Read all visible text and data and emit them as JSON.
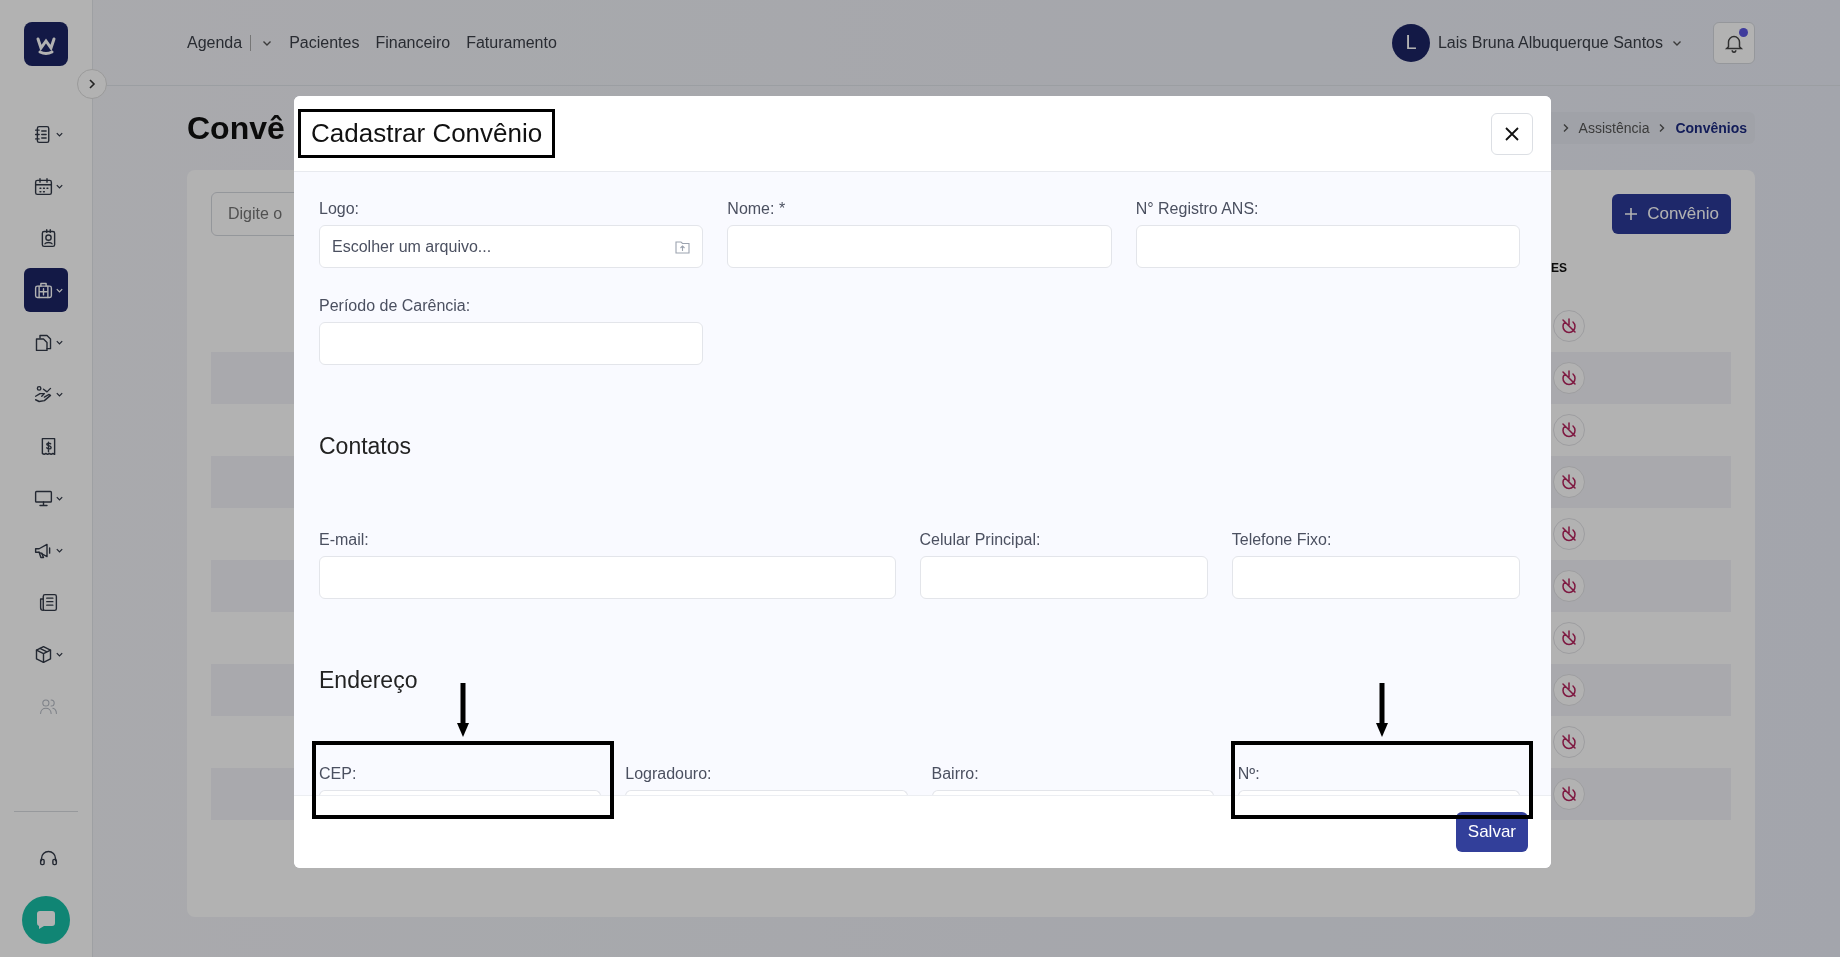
{
  "sidebar": {
    "items": [
      {
        "selected": false,
        "expandable": true,
        "disabled": false
      },
      {
        "selected": false,
        "expandable": true,
        "disabled": false
      },
      {
        "selected": false,
        "expandable": false,
        "disabled": false
      },
      {
        "selected": true,
        "expandable": true,
        "disabled": false
      },
      {
        "selected": false,
        "expandable": true,
        "disabled": false
      },
      {
        "selected": false,
        "expandable": true,
        "disabled": false
      },
      {
        "selected": false,
        "expandable": false,
        "disabled": false
      },
      {
        "selected": false,
        "expandable": true,
        "disabled": false
      },
      {
        "selected": false,
        "expandable": true,
        "disabled": false
      },
      {
        "selected": false,
        "expandable": false,
        "disabled": false
      },
      {
        "selected": false,
        "expandable": true,
        "disabled": false
      },
      {
        "selected": false,
        "expandable": false,
        "disabled": true
      }
    ]
  },
  "top_nav": [
    {
      "label": "Agenda",
      "dropdown": true
    },
    {
      "label": "Pacientes",
      "dropdown": false
    },
    {
      "label": "Financeiro",
      "dropdown": false
    },
    {
      "label": "Faturamento",
      "dropdown": false
    }
  ],
  "user": {
    "initial": "L",
    "name": "Lais Bruna Albuquerque Santos"
  },
  "notifications": {
    "unread": true
  },
  "page": {
    "title": "Convê",
    "breadcrumb": [
      {
        "label": "Assistência",
        "current": false
      },
      {
        "label": "Convênios",
        "current": true
      }
    ],
    "search": {
      "placeholder": "Digite o"
    },
    "add_button": "Convênio",
    "column_header": "ES",
    "rows": [
      {
        "enabled": false
      },
      {
        "enabled": false
      },
      {
        "enabled": false
      },
      {
        "enabled": false
      },
      {
        "enabled": false
      },
      {
        "enabled": false
      },
      {
        "enabled": false
      },
      {
        "enabled": false
      },
      {
        "enabled": false
      },
      {
        "enabled": false
      }
    ]
  },
  "modal": {
    "title": "Cadastrar Convênio",
    "title_highlighted": true,
    "sections": [
      {
        "fields": [
          {
            "label": "Logo:",
            "kind": "file",
            "placeholder": "Escolher um arquivo...",
            "highlighted": false
          },
          {
            "label": "Nome: *",
            "kind": "text",
            "highlighted": false
          },
          {
            "label": "N° Registro ANS:",
            "kind": "text",
            "highlighted": false
          },
          {
            "label": "Período de Carência:",
            "kind": "text",
            "highlighted": false
          }
        ]
      },
      {
        "heading": "Contatos",
        "fields": [
          {
            "label": "E-mail:",
            "kind": "text",
            "highlighted": false
          },
          {
            "label": "Celular Principal:",
            "kind": "text",
            "highlighted": false
          },
          {
            "label": "Telefone Fixo:",
            "kind": "text",
            "highlighted": false
          }
        ]
      },
      {
        "heading": "Endereço",
        "fields": [
          {
            "label": "CEP:",
            "kind": "text",
            "highlighted": true
          },
          {
            "label": "Logradouro:",
            "kind": "text",
            "highlighted": false
          },
          {
            "label": "Bairro:",
            "kind": "text",
            "highlighted": false
          },
          {
            "label": "Nº:",
            "kind": "text",
            "highlighted": true
          }
        ]
      }
    ],
    "save_button": "Salvar"
  }
}
